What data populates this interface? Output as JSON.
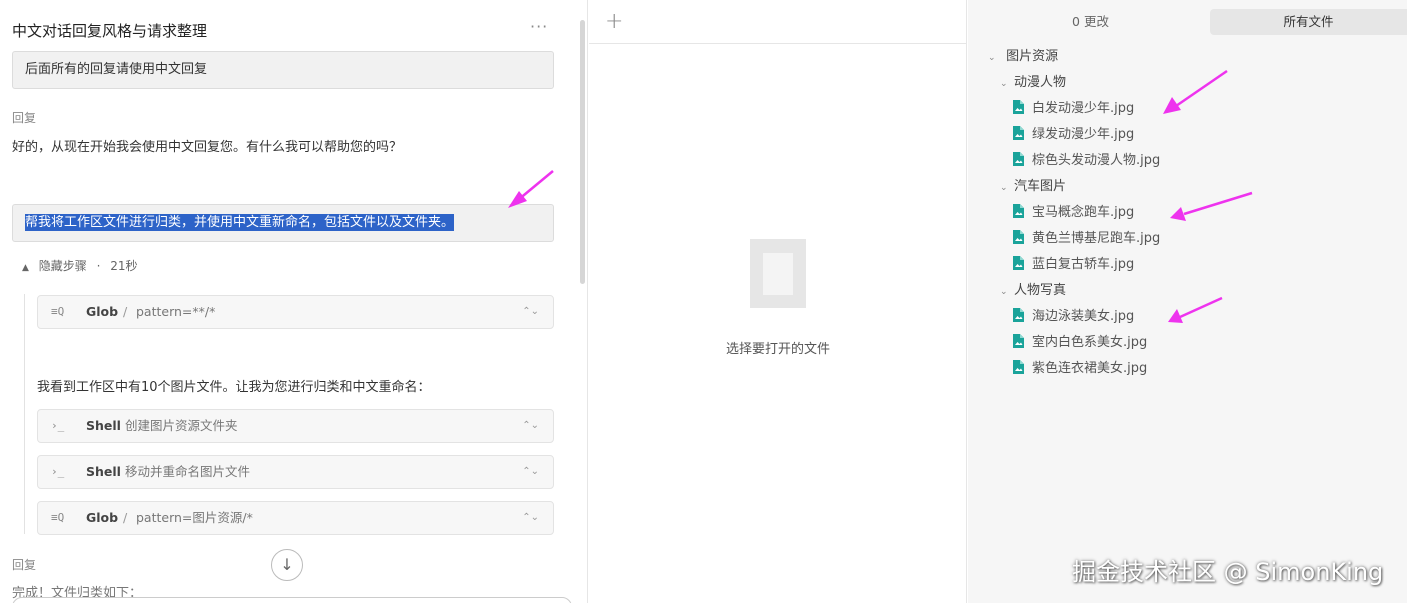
{
  "chat": {
    "title": "中文对话回复风格与请求整理",
    "more_label": "···",
    "messages": [
      {
        "user": "后面所有的回复请使用中文回复"
      },
      {
        "reply_label": "回复",
        "reply": "好的，从现在开始我会使用中文回复您。有什么我可以帮助您的吗？"
      },
      {
        "user": "帮我将工作区文件进行归类，并使用中文重新命名，包括文件以及文件夹。"
      }
    ],
    "steps": {
      "caret": "▲",
      "label": "隐藏步骤",
      "dot": "·",
      "duration": "21秒"
    },
    "tools": [
      {
        "icon": "search-icon",
        "glyph": "≡Q",
        "name": "Glob",
        "sep": "/",
        "arg": "pattern=**/*",
        "chevron": "⌃⌄"
      },
      {
        "icon": "terminal-icon",
        "glyph": "›_",
        "name": "Shell",
        "sep": "",
        "arg": "创建图片资源文件夹",
        "chevron": "⌃⌄"
      },
      {
        "icon": "terminal-icon",
        "glyph": "›_",
        "name": "Shell",
        "sep": "",
        "arg": "移动并重命名图片文件",
        "chevron": "⌃⌄"
      },
      {
        "icon": "search-icon",
        "glyph": "≡Q",
        "name": "Glob",
        "sep": "/",
        "arg": "pattern=图片资源/*",
        "chevron": "⌃⌄"
      }
    ],
    "mid_text": "我看到工作区中有10个图片文件。让我为您进行归类和中文重命名：",
    "final_reply_label": "回复",
    "final_reply": "完成！文件归类如下：",
    "scroll_down_glyph": "↓"
  },
  "editor": {
    "add_tab_glyph": "+",
    "empty_text": "选择要打开的文件"
  },
  "files": {
    "tabs": {
      "changes": "0 更改",
      "all": "所有文件"
    },
    "root": {
      "name": "图片资源",
      "caret": "⌄"
    },
    "folders": [
      {
        "name": "动漫人物",
        "caret": "⌄",
        "files": [
          "白发动漫少年.jpg",
          "绿发动漫少年.jpg",
          "棕色头发动漫人物.jpg"
        ]
      },
      {
        "name": "汽车图片",
        "caret": "⌄",
        "files": [
          "宝马概念跑车.jpg",
          "黄色兰博基尼跑车.jpg",
          "蓝白复古轿车.jpg"
        ]
      },
      {
        "name": "人物写真",
        "caret": "⌄",
        "files": [
          "海边泳装美女.jpg",
          "室内白色系美女.jpg",
          "紫色连衣裙美女.jpg"
        ]
      }
    ],
    "file_icon_color": "#1aa39a"
  },
  "colors": {
    "highlight": "#2d63c8",
    "arrow": "#ee33ee"
  },
  "watermark": "掘金技术社区 @ SimonKing"
}
